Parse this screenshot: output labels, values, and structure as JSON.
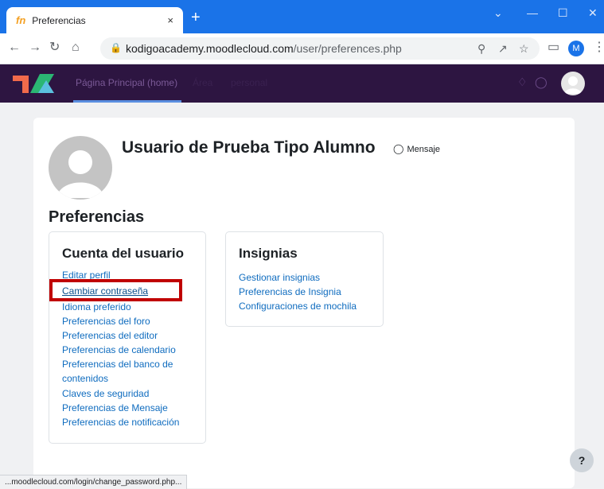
{
  "browser": {
    "tab_title": "Preferencias",
    "tab_favicon": "fn",
    "tab_close": "×",
    "new_tab": "+",
    "url_host": "kodigoacademy.moodlecloud.com",
    "url_path": "/user/preferences.php",
    "profile_initial": "M",
    "status_url": "...moodlecloud.com/login/change_password.php..."
  },
  "navbar": {
    "home": "Página Principal (home)",
    "item2": "Área",
    "item3": "personal"
  },
  "user": {
    "name": "Usuario de Prueba Tipo Alumno",
    "message_label": "Mensaje"
  },
  "page": {
    "title": "Preferencias"
  },
  "account": {
    "heading": "Cuenta del usuario",
    "links": [
      "Editar perfil",
      "Cambiar contraseña",
      "Idioma preferido",
      "Preferencias del foro",
      "Preferencias del editor",
      "Preferencias de calendario",
      "Preferencias del banco de",
      "contenidos",
      "Claves de seguridad",
      "Preferencias de Mensaje",
      "Preferencias de notificación"
    ]
  },
  "badges": {
    "heading": "Insignias",
    "links": [
      "Gestionar insignias",
      "Preferencias de Insignia",
      "Configuraciones de mochila"
    ]
  },
  "help": "?",
  "colors": {
    "chrome_blue": "#1a73e8",
    "navbar_purple": "#2d1541",
    "link_blue": "#0f6cbf",
    "highlight_red": "#c00000"
  }
}
